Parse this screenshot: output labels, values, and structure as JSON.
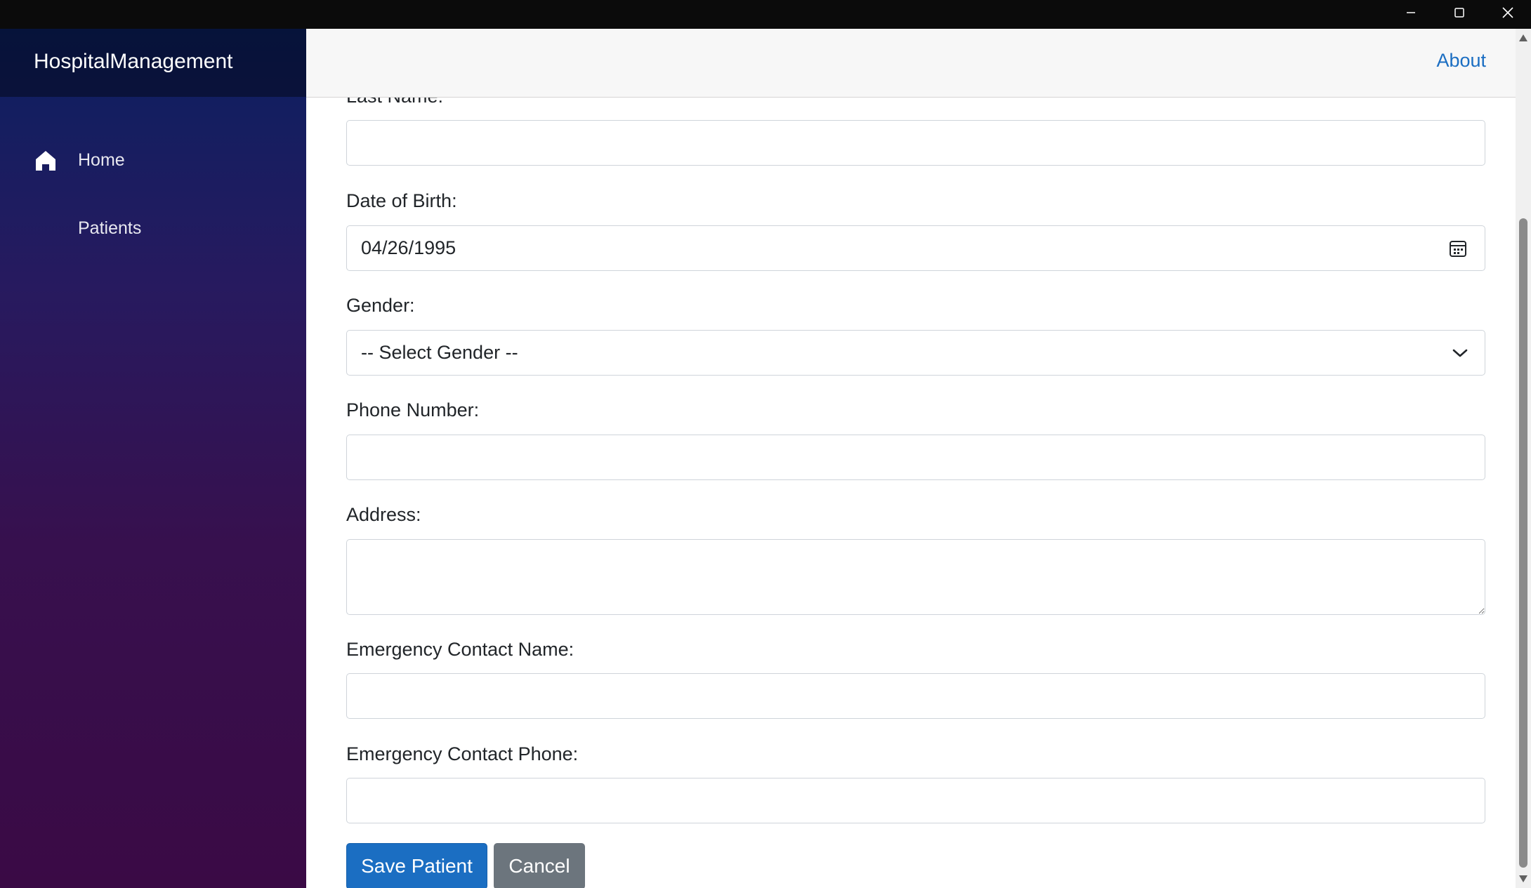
{
  "window": {
    "controls": [
      "minimize",
      "maximize",
      "close"
    ]
  },
  "sidebar": {
    "brand": "HospitalManagement",
    "items": [
      {
        "label": "Home",
        "icon": "home-icon"
      },
      {
        "label": "Patients",
        "icon": ""
      }
    ]
  },
  "header": {
    "about_label": "About"
  },
  "form": {
    "last_name_label": "Last Name:",
    "last_name_value": "",
    "dob_label": "Date of Birth:",
    "dob_value": "04/26/1995",
    "gender_label": "Gender:",
    "gender_value": "-- Select Gender --",
    "phone_label": "Phone Number:",
    "phone_value": "",
    "address_label": "Address:",
    "address_value": "",
    "emergency_name_label": "Emergency Contact Name:",
    "emergency_name_value": "",
    "emergency_phone_label": "Emergency Contact Phone:",
    "emergency_phone_value": "",
    "save_label": "Save Patient",
    "cancel_label": "Cancel"
  },
  "colors": {
    "primary": "#1b6ec2",
    "secondary": "#6c757d",
    "link": "#1b6ec2",
    "sidebar_top": "#0b2061",
    "sidebar_bottom": "#3a0a45"
  }
}
